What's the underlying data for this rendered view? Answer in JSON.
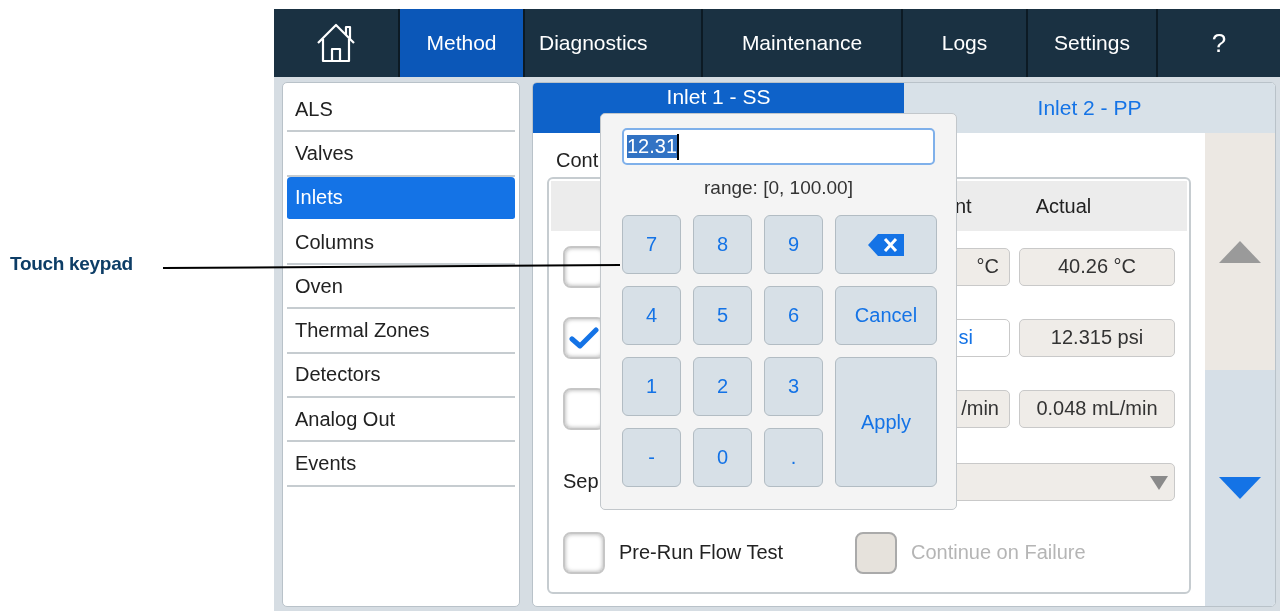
{
  "callout": {
    "label": "Touch keypad"
  },
  "nav": {
    "tabs": [
      {
        "label": "Method",
        "selected": true
      },
      {
        "label": "Diagnostics",
        "selected": false
      },
      {
        "label": "Maintenance",
        "selected": false
      },
      {
        "label": "Logs",
        "selected": false
      },
      {
        "label": "Settings",
        "selected": false
      },
      {
        "label": "?",
        "selected": false
      }
    ]
  },
  "sidebar": {
    "items": [
      {
        "label": "ALS",
        "selected": false
      },
      {
        "label": "Valves",
        "selected": false
      },
      {
        "label": "Inlets",
        "selected": true
      },
      {
        "label": "Columns",
        "selected": false
      },
      {
        "label": "Oven",
        "selected": false
      },
      {
        "label": "Thermal Zones",
        "selected": false
      },
      {
        "label": "Detectors",
        "selected": false
      },
      {
        "label": "Analog Out",
        "selected": false
      },
      {
        "label": "Events",
        "selected": false
      }
    ]
  },
  "inlet_tabs": [
    {
      "label": "Inlet 1 - SS",
      "selected": true
    },
    {
      "label": "Inlet 2 - PP",
      "selected": false
    }
  ],
  "content": {
    "section_label": "Cont",
    "header": {
      "setpoint": "nt",
      "actual": "Actual"
    },
    "rows": [
      {
        "checked": false,
        "setpoint": "°C",
        "actual": "40.26 °C",
        "editable": false
      },
      {
        "checked": true,
        "setpoint": "si",
        "actual": "12.315 psi",
        "editable": true
      },
      {
        "checked": false,
        "setpoint": "/min",
        "actual": "0.048 mL/min",
        "editable": false
      }
    ],
    "select_label": "Sep",
    "options": [
      {
        "label": "Pre-Run Flow Test",
        "checked": false,
        "disabled": false
      },
      {
        "label": "Continue on Failure",
        "checked": false,
        "disabled": true
      }
    ]
  },
  "scroll": {
    "up_disabled": true,
    "down_disabled": false
  },
  "keypad": {
    "value": "12.31",
    "range": "range: [0, 100.00]",
    "keys": [
      {
        "kind": "digit",
        "label": "7"
      },
      {
        "kind": "digit",
        "label": "8"
      },
      {
        "kind": "digit",
        "label": "9"
      },
      {
        "kind": "backspace"
      },
      {
        "kind": "digit",
        "label": "4"
      },
      {
        "kind": "digit",
        "label": "5"
      },
      {
        "kind": "digit",
        "label": "6"
      },
      {
        "kind": "cancel",
        "label": "Cancel"
      },
      {
        "kind": "digit",
        "label": "1"
      },
      {
        "kind": "digit",
        "label": "2"
      },
      {
        "kind": "digit",
        "label": "3"
      },
      {
        "kind": "apply",
        "label": "Apply"
      },
      {
        "kind": "digit",
        "label": "-"
      },
      {
        "kind": "digit",
        "label": "0"
      },
      {
        "kind": "digit",
        "label": "."
      }
    ]
  }
}
